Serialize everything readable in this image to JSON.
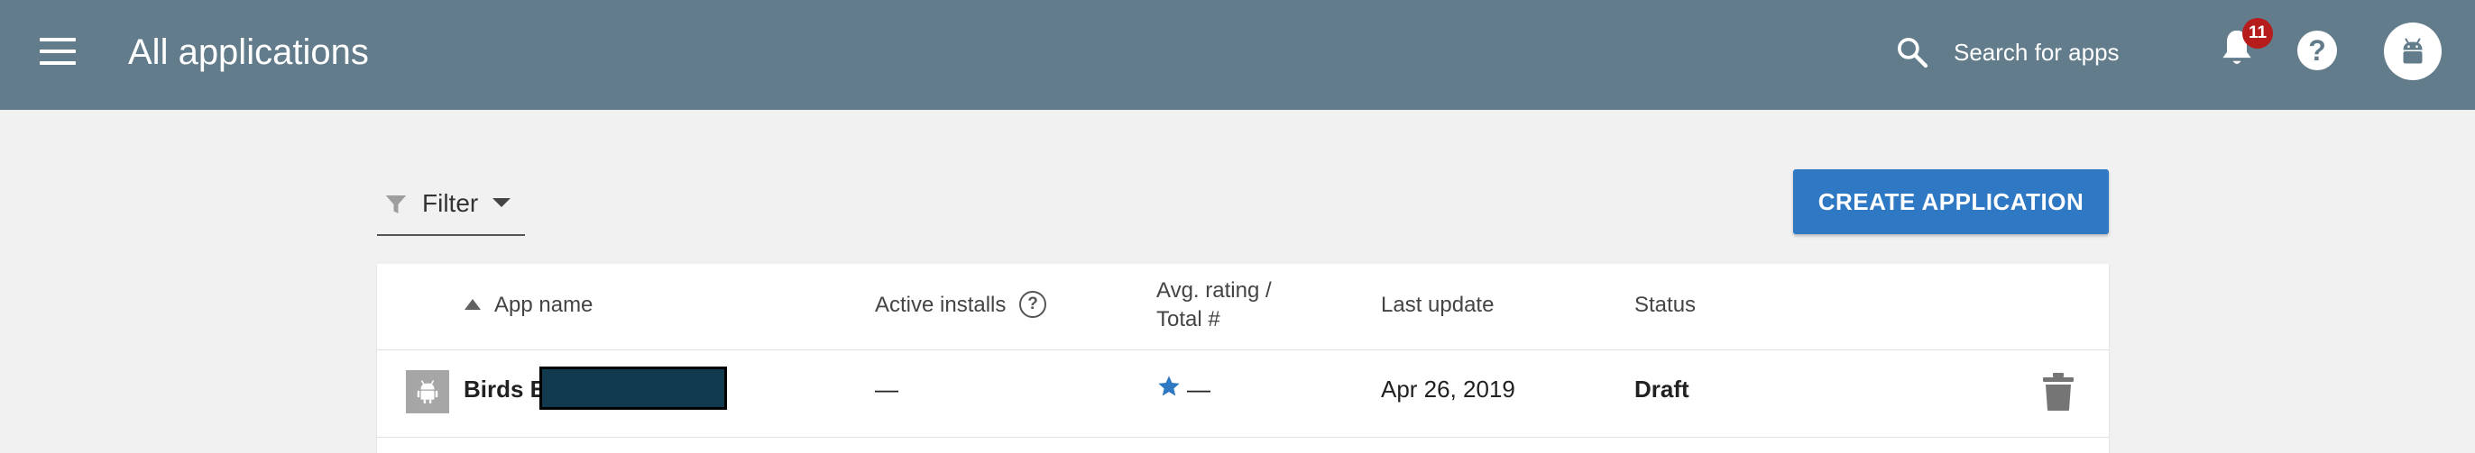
{
  "header": {
    "title": "All applications",
    "search_placeholder": "Search for apps",
    "notification_count": "11",
    "help_glyph": "?",
    "icons": {
      "menu": "menu-icon",
      "search": "search-icon",
      "notifications": "bell-icon",
      "help": "help-icon",
      "avatar": "android-avatar-icon"
    }
  },
  "toolbar": {
    "filter_label": "Filter",
    "create_button": "CREATE APPLICATION"
  },
  "table": {
    "columns": {
      "app_name": "App name",
      "active_installs": "Active installs",
      "rating_line1": "Avg. rating /",
      "rating_line2": "Total #",
      "last_update": "Last update",
      "status": "Status"
    },
    "sort": {
      "column": "App name",
      "direction": "ascending"
    },
    "rows": [
      {
        "app_name": "Birds E",
        "active_installs": "—",
        "rating": "—",
        "last_update": "Apr 26, 2019",
        "status": "Draft"
      }
    ]
  },
  "colors": {
    "header_bg": "#627c8b",
    "page_bg": "#f1f1f1",
    "primary_button": "#2f78c4",
    "badge": "#b71c1c",
    "star": "#2f78c4"
  }
}
